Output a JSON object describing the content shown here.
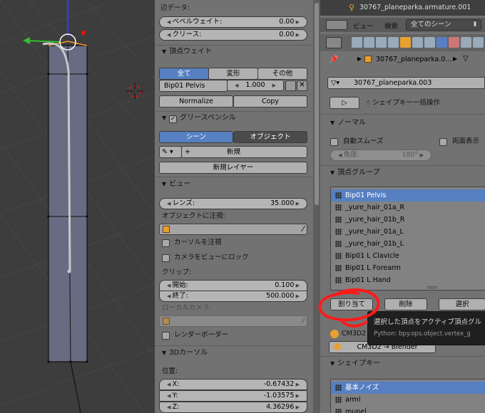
{
  "np": {
    "edge_data_header": "辺データ:",
    "bevel_weight": {
      "label": "ベベルウェイト:",
      "value": "0.00"
    },
    "crease": {
      "label": "クリース:",
      "value": "0.00"
    },
    "vertex_weights_header": "頂点ウェイト",
    "vw_tabs": [
      "全て",
      "変形",
      "その他"
    ],
    "vw_group": {
      "name": "Bip01 Pelvis",
      "value": "1.000"
    },
    "normalize_label": "Normalize",
    "copy_label": "Copy",
    "grease_header": "グリースペンシル",
    "grease_tabs": [
      "シーン",
      "オブジェクト"
    ],
    "new_label": "新規",
    "new_layer_label": "新規レイヤー",
    "view_header": "ビュー",
    "lens": {
      "label": "レンズ:",
      "value": "35.000"
    },
    "lock_object_label": "オブジェクトに注視:",
    "lock_cursor_label": "カーソルを注視",
    "lock_camera_label": "カメラをビューにロック",
    "clip_label": "クリップ:",
    "clip_start": {
      "label": "開始:",
      "value": "0.100"
    },
    "clip_end": {
      "label": "終了:",
      "value": "500.000"
    },
    "local_camera_label": "ローカルカメラ:",
    "render_border_label": "レンダーボーダー",
    "cursor_header": "3Dカーソル",
    "location_label": "位置:",
    "cx": {
      "label": "X:",
      "value": "-0.67432"
    },
    "cy": {
      "label": "Y:",
      "value": "-1.03575"
    },
    "cz": {
      "label": "Z:",
      "value": "4.36296"
    }
  },
  "pp": {
    "outliner_item": "30767_planeparka.armature.001",
    "header_view": "ビュー",
    "header_search": "検索",
    "header_scene_select": "全てのシーン",
    "breadcrumb": "30767_planeparka.0...",
    "mesh_name": "30767_planeparka.003",
    "shapekey_bulk": "シェイプキー一括操作",
    "normal_header": "ノーマル",
    "auto_smooth": "自動スムーズ",
    "double_sided": "両面表示",
    "angle": {
      "label": "角度:",
      "value": "180°"
    },
    "vgroup_header": "頂点グループ",
    "vgroups": [
      "Bip01 Pelvis",
      "_yure_hair_01a_R",
      "_yure_hair_01b_R",
      "_yure_hair_01a_L",
      "_yure_hair_01b_L",
      "Bip01 L Clavicle",
      "Bip01 L Forearm",
      "Bip01 L Hand"
    ],
    "assign_label": "割り当て",
    "remove_label": "削除",
    "select_label": "選択",
    "cm3d2_label": "CM3D2",
    "cm3d2_blender": "CM3D2 → Blender",
    "shapekey_header": "シェイプキー",
    "shapekeys": [
      "基本ノイズ",
      "arml",
      "munel"
    ]
  },
  "tooltip": {
    "text": "選択した頂点をアクティブ頂点グルー",
    "python": "Python: bpy.ops.object.vertex_g"
  },
  "colors": {
    "accent_blue": "#5680c2",
    "annotation_red": "#ff1a1a"
  }
}
